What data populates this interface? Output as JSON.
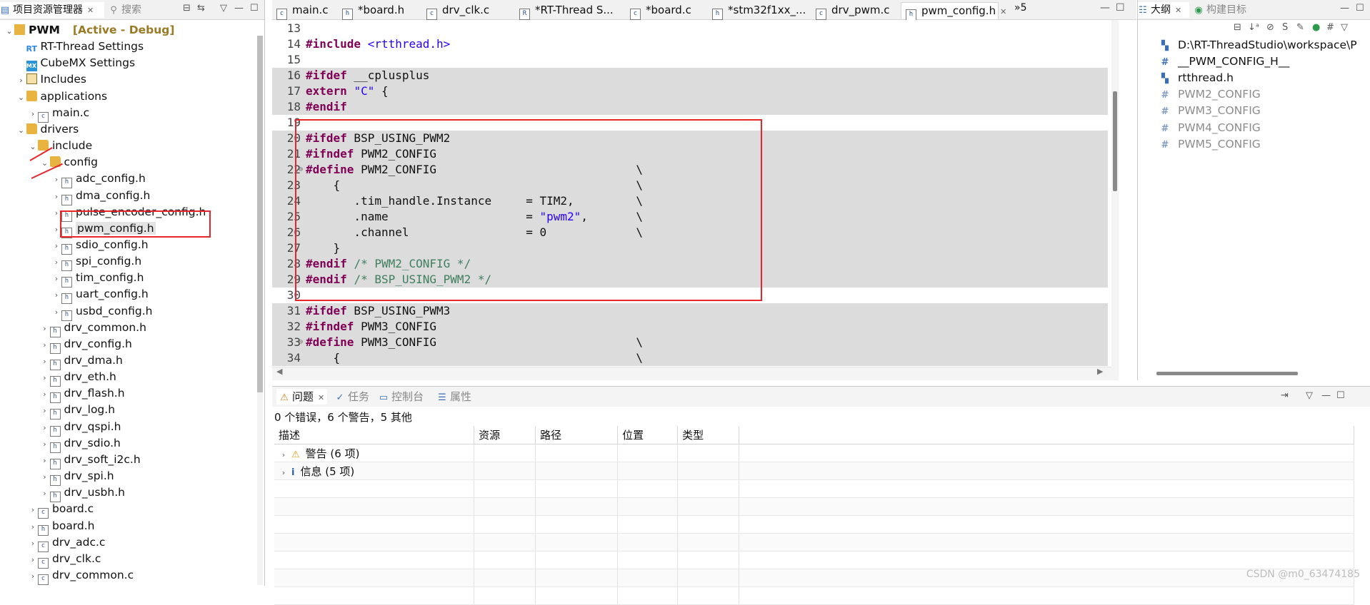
{
  "explorer": {
    "title": "项目资源管理器",
    "search_tab": "搜索",
    "tree": [
      {
        "label": "PWM",
        "tag": "[Active - Debug]",
        "icon": "project-icon",
        "depth": 0,
        "arrow": "v"
      },
      {
        "label": "RT-Thread Settings",
        "icon": "rt-settings-icon",
        "depth": 1,
        "arrow": ""
      },
      {
        "label": "CubeMX Settings",
        "icon": "cubemx-icon",
        "depth": 1,
        "arrow": ""
      },
      {
        "label": "Includes",
        "icon": "includes-icon",
        "depth": 1,
        "arrow": ">"
      },
      {
        "label": "applications",
        "icon": "folder-icon",
        "depth": 1,
        "arrow": "v"
      },
      {
        "label": "main.c",
        "icon": "c-file-icon",
        "depth": 2,
        "arrow": ">"
      },
      {
        "label": "drivers",
        "icon": "folder-icon",
        "depth": 1,
        "arrow": "v"
      },
      {
        "label": "include",
        "icon": "folder-icon",
        "depth": 2,
        "arrow": "v"
      },
      {
        "label": "config",
        "icon": "folder-icon",
        "depth": 3,
        "arrow": "v"
      },
      {
        "label": "adc_config.h",
        "icon": "h-file-icon",
        "depth": 4,
        "arrow": ">"
      },
      {
        "label": "dma_config.h",
        "icon": "h-file-icon",
        "depth": 4,
        "arrow": ">"
      },
      {
        "label": "pulse_encoder_config.h",
        "icon": "h-file-icon",
        "depth": 4,
        "arrow": ">"
      },
      {
        "label": "pwm_config.h",
        "icon": "h-file-icon",
        "depth": 4,
        "arrow": ">",
        "selected": true
      },
      {
        "label": "sdio_config.h",
        "icon": "h-file-icon",
        "depth": 4,
        "arrow": ">"
      },
      {
        "label": "spi_config.h",
        "icon": "h-file-icon",
        "depth": 4,
        "arrow": ">"
      },
      {
        "label": "tim_config.h",
        "icon": "h-file-icon",
        "depth": 4,
        "arrow": ">"
      },
      {
        "label": "uart_config.h",
        "icon": "h-file-icon",
        "depth": 4,
        "arrow": ">"
      },
      {
        "label": "usbd_config.h",
        "icon": "h-file-icon",
        "depth": 4,
        "arrow": ">"
      },
      {
        "label": "drv_common.h",
        "icon": "h-file-icon",
        "depth": 3,
        "arrow": ">"
      },
      {
        "label": "drv_config.h",
        "icon": "h-file-icon",
        "depth": 3,
        "arrow": ">"
      },
      {
        "label": "drv_dma.h",
        "icon": "h-file-icon",
        "depth": 3,
        "arrow": ">"
      },
      {
        "label": "drv_eth.h",
        "icon": "h-file-icon",
        "depth": 3,
        "arrow": ">"
      },
      {
        "label": "drv_flash.h",
        "icon": "h-file-icon",
        "depth": 3,
        "arrow": ">"
      },
      {
        "label": "drv_log.h",
        "icon": "h-file-icon",
        "depth": 3,
        "arrow": ">"
      },
      {
        "label": "drv_qspi.h",
        "icon": "h-file-icon",
        "depth": 3,
        "arrow": ">"
      },
      {
        "label": "drv_sdio.h",
        "icon": "h-file-icon",
        "depth": 3,
        "arrow": ">"
      },
      {
        "label": "drv_soft_i2c.h",
        "icon": "h-file-icon",
        "depth": 3,
        "arrow": ">"
      },
      {
        "label": "drv_spi.h",
        "icon": "h-file-icon",
        "depth": 3,
        "arrow": ">"
      },
      {
        "label": "drv_usbh.h",
        "icon": "h-file-icon",
        "depth": 3,
        "arrow": ">"
      },
      {
        "label": "board.c",
        "icon": "c-file-icon",
        "depth": 2,
        "arrow": ">"
      },
      {
        "label": "board.h",
        "icon": "h-file-icon",
        "depth": 2,
        "arrow": ">"
      },
      {
        "label": "drv_adc.c",
        "icon": "c-file-icon",
        "depth": 2,
        "arrow": ">"
      },
      {
        "label": "drv_clk.c",
        "icon": "c-file-icon",
        "depth": 2,
        "arrow": ">"
      },
      {
        "label": "drv_common.c",
        "icon": "c-file-icon",
        "depth": 2,
        "arrow": ">"
      }
    ]
  },
  "editor": {
    "tabs": [
      {
        "label": "main.c",
        "icon": "c-file-icon"
      },
      {
        "label": "*board.h",
        "icon": "h-file-icon"
      },
      {
        "label": "drv_clk.c",
        "icon": "c-file-icon"
      },
      {
        "label": "*RT-Thread S...",
        "icon": "rt-settings-icon"
      },
      {
        "label": "*board.c",
        "icon": "c-file-icon"
      },
      {
        "label": "*stm32f1xx_...",
        "icon": "h-file-icon"
      },
      {
        "label": "drv_pwm.c",
        "icon": "c-file-icon"
      },
      {
        "label": "pwm_config.h",
        "icon": "h-file-icon",
        "active": true
      }
    ],
    "overflow_label": "»5",
    "lines": [
      {
        "n": "13",
        "code": [],
        "hl": false
      },
      {
        "n": "14",
        "code": [
          [
            "kw",
            "#include"
          ],
          [
            "t",
            " "
          ],
          [
            "str",
            "<rtthread.h>"
          ]
        ],
        "hl": false
      },
      {
        "n": "15",
        "code": [],
        "hl": false
      },
      {
        "n": "16",
        "code": [
          [
            "kw",
            "#ifdef"
          ],
          [
            "t",
            " __cplusplus"
          ]
        ],
        "hl": true
      },
      {
        "n": "17",
        "code": [
          [
            "kw",
            "extern"
          ],
          [
            "t",
            " "
          ],
          [
            "str",
            "\"C\""
          ],
          [
            "t",
            " {"
          ]
        ],
        "hl": true
      },
      {
        "n": "18",
        "code": [
          [
            "kw",
            "#endif"
          ]
        ],
        "hl": true
      },
      {
        "n": "19",
        "code": [],
        "hl": false
      },
      {
        "n": "20",
        "code": [
          [
            "kw",
            "#ifdef"
          ],
          [
            "t",
            " BSP_USING_PWM2"
          ]
        ],
        "hl": true
      },
      {
        "n": "21",
        "code": [
          [
            "kw",
            "#ifndef"
          ],
          [
            "t",
            " PWM2_CONFIG"
          ]
        ],
        "hl": true
      },
      {
        "n": "22",
        "code": [
          [
            "kw",
            "#define"
          ],
          [
            "t",
            " PWM2_CONFIG                             \\"
          ]
        ],
        "hl": true,
        "fold": true
      },
      {
        "n": "23",
        "code": [
          [
            "t",
            "    {                                           \\"
          ]
        ],
        "hl": true
      },
      {
        "n": "24",
        "code": [
          [
            "t",
            "       .tim_handle.Instance     = TIM2,         \\"
          ]
        ],
        "hl": true
      },
      {
        "n": "25",
        "code": [
          [
            "t",
            "       .name                    = "
          ],
          [
            "str",
            "\"pwm2\""
          ],
          [
            "t",
            ",       \\"
          ]
        ],
        "hl": true
      },
      {
        "n": "26",
        "code": [
          [
            "t",
            "       .channel                 = 0             \\"
          ]
        ],
        "hl": true
      },
      {
        "n": "27",
        "code": [
          [
            "t",
            "    }"
          ]
        ],
        "hl": true
      },
      {
        "n": "28",
        "code": [
          [
            "kw",
            "#endif"
          ],
          [
            "t",
            " "
          ],
          [
            "cmt",
            "/* PWM2_CONFIG */"
          ]
        ],
        "hl": true
      },
      {
        "n": "29",
        "code": [
          [
            "kw",
            "#endif"
          ],
          [
            "t",
            " "
          ],
          [
            "cmt",
            "/* BSP_USING_PWM2 */"
          ]
        ],
        "hl": true
      },
      {
        "n": "30",
        "code": [],
        "hl": false
      },
      {
        "n": "31",
        "code": [
          [
            "kw",
            "#ifdef"
          ],
          [
            "t",
            " BSP_USING_PWM3"
          ]
        ],
        "hl": true
      },
      {
        "n": "32",
        "code": [
          [
            "kw",
            "#ifndef"
          ],
          [
            "t",
            " PWM3_CONFIG"
          ]
        ],
        "hl": true
      },
      {
        "n": "33",
        "code": [
          [
            "kw",
            "#define"
          ],
          [
            "t",
            " PWM3_CONFIG                             \\"
          ]
        ],
        "hl": true,
        "fold": true
      },
      {
        "n": "34",
        "code": [
          [
            "t",
            "    {                                           \\"
          ]
        ],
        "hl": true
      }
    ]
  },
  "outline": {
    "title": "大纲",
    "build_tab": "构建目标",
    "items": [
      {
        "label": "D:\\RT-ThreadStudio\\workspace\\P",
        "icon": "include-icon",
        "dim": false
      },
      {
        "label": "__PWM_CONFIG_H__",
        "icon": "macro-hash-icon",
        "dim": false
      },
      {
        "label": "rtthread.h",
        "icon": "include-icon",
        "dim": false
      },
      {
        "label": "PWM2_CONFIG",
        "icon": "macro-hash-icon",
        "dim": true
      },
      {
        "label": "PWM3_CONFIG",
        "icon": "macro-hash-icon",
        "dim": true
      },
      {
        "label": "PWM4_CONFIG",
        "icon": "macro-hash-icon",
        "dim": true
      },
      {
        "label": "PWM5_CONFIG",
        "icon": "macro-hash-icon",
        "dim": true
      }
    ]
  },
  "problems": {
    "tabs": [
      {
        "label": "问题",
        "icon": "problems-icon",
        "active": true
      },
      {
        "label": "任务",
        "icon": "tasks-icon"
      },
      {
        "label": "控制台",
        "icon": "console-icon"
      },
      {
        "label": "属性",
        "icon": "properties-icon"
      }
    ],
    "summary": "0 个错误，6 个警告，5 其他",
    "columns": [
      "描述",
      "资源",
      "路径",
      "位置",
      "类型"
    ],
    "rows": [
      {
        "label": "警告 (6 项)",
        "icon": "warning-icon"
      },
      {
        "label": "信息 (5 项)",
        "icon": "info-icon"
      }
    ]
  },
  "watermark": "CSDN @m0_63474185"
}
